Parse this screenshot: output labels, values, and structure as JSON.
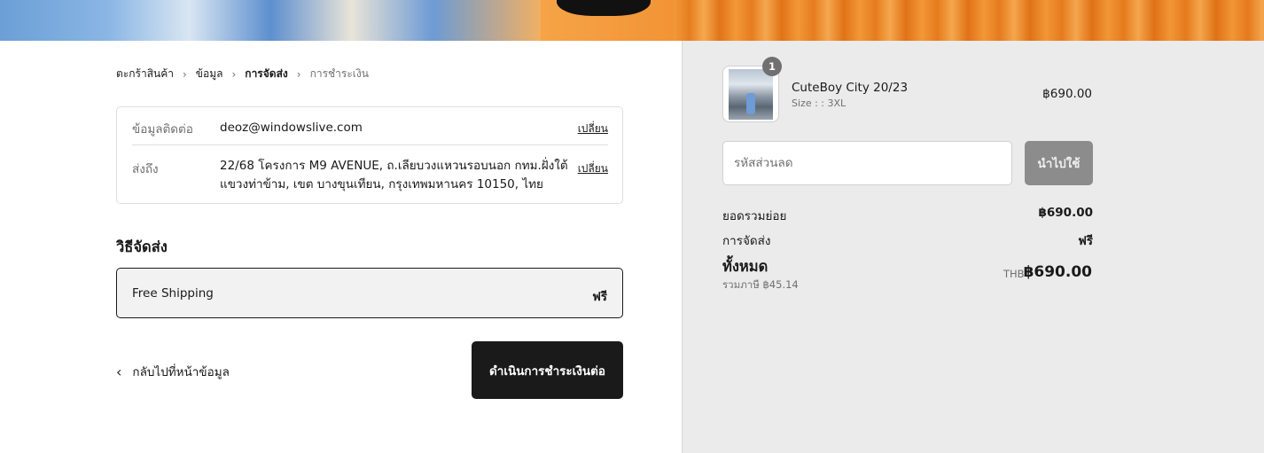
{
  "breadcrumb": {
    "items": [
      "ตะกร้าสินค้า",
      "ข้อมูล",
      "การจัดส่ง",
      "การชำระเงิน"
    ],
    "current_index": 2
  },
  "review": {
    "contact_label": "ข้อมูลติดต่อ",
    "contact_value": "deoz@windowslive.com",
    "ship_to_label": "ส่งถึง",
    "ship_to_value": "22/68 โครงการ M9 AVENUE, ถ.เลียบวงแหวนรอบนอก กทม.ฝั่งใต้ แขวงท่าข้าม, เขต บางขุนเทียน, กรุงเทพมหานคร 10150, ไทย",
    "change_label": "เปลี่ยน"
  },
  "shipping_method": {
    "title": "วิธีจัดส่ง",
    "option_name": "Free Shipping",
    "option_price": "ฟรี"
  },
  "actions": {
    "back_label": "กลับไปที่หน้าข้อมูล",
    "continue_label": "ดำเนินการชำระเงินต่อ"
  },
  "order": {
    "item": {
      "quantity": "1",
      "name": "CuteBoy City 20/23",
      "variant": "Size : : 3XL",
      "price": "฿690.00"
    },
    "discount": {
      "placeholder": "รหัสส่วนลด",
      "apply_label": "นำไปใช้"
    },
    "subtotal_label": "ยอดรวมย่อย",
    "subtotal_value": "฿690.00",
    "shipping_label": "การจัดส่ง",
    "shipping_value": "ฟรี",
    "total_label": "ทั้งหมด",
    "tax_note": "รวมภาษี ฿45.14",
    "currency": "THB",
    "total_value": "฿690.00"
  },
  "colors": {
    "primary_button": "#1a1a1a",
    "apply_button": "#8c8c8c",
    "sidebar_bg": "#ebebeb",
    "muted_text": "#707070"
  }
}
